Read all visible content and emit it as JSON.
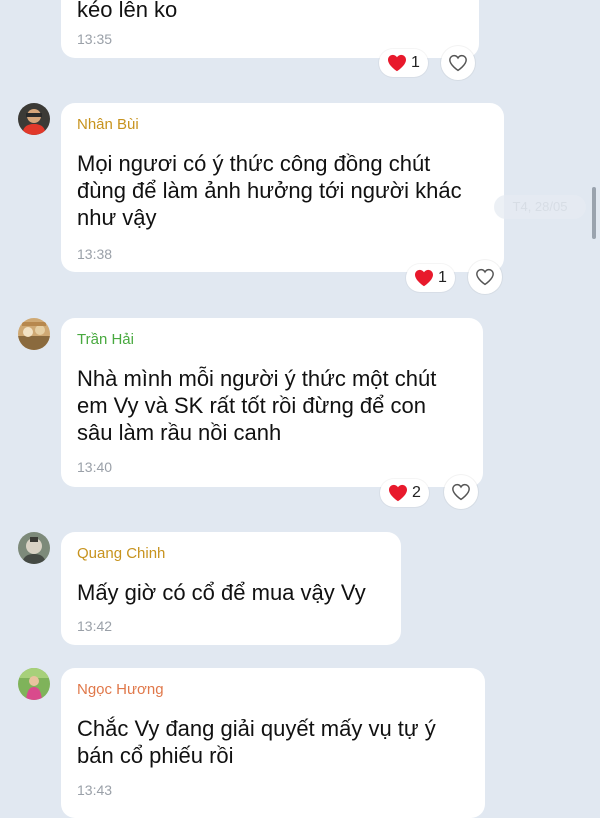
{
  "date_chip": "T4, 28/05",
  "colors": {
    "background": "#e1e8f1",
    "bubble": "#ffffff",
    "heart": "#e8192c",
    "time": "#9aa0a8"
  },
  "messages": [
    {
      "sender": "",
      "sender_color": "",
      "text": "kéo lên ko",
      "time": "13:35",
      "reaction_icon": "heart-icon",
      "reaction_count": "1"
    },
    {
      "sender": "Nhân Bùi",
      "sender_color": "#c7931e",
      "text": "Mọi ngươi có ý thức công đồng chút\nđùng để làm ảnh hưởng tới người khác\nnhư vậy",
      "time": "13:38",
      "reaction_icon": "heart-icon",
      "reaction_count": "1"
    },
    {
      "sender": "Trần Hải",
      "sender_color": "#48a93f",
      "text": "Nhà mình mỗi người ý thức một chút\nem Vy và SK rất tốt rồi đừng để con\nsâu làm rầu nồi canh",
      "time": "13:40",
      "reaction_icon": "heart-icon",
      "reaction_count": "2"
    },
    {
      "sender": "Quang Chinh",
      "sender_color": "#c7931e",
      "text": "Mấy giờ có cổ để mua vậy Vy",
      "time": "13:42"
    },
    {
      "sender": "Ngọc Hương",
      "sender_color": "#e0784a",
      "text": "Chắc Vy đang giải quyết mấy vụ tự ý\nbán cổ phiếu rồi",
      "time": "13:43"
    }
  ]
}
